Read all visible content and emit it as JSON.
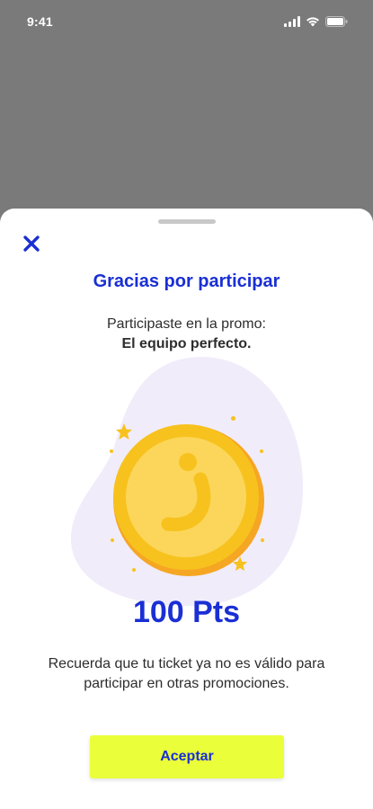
{
  "status_bar": {
    "time": "9:41",
    "icons": [
      "cellular-signal-icon",
      "wifi-icon",
      "battery-icon"
    ]
  },
  "modal": {
    "close_icon": "close-icon",
    "title": "Gracias por participar",
    "subtitle_line1": "Participaste en la promo:",
    "promo_name": "El equipo perfecto.",
    "coin_icon": "coin-icon",
    "points": "100 Pts",
    "notice": "Recuerda que tu ticket ya no es válido para participar en otras promociones.",
    "accept_label": "Aceptar"
  },
  "colors": {
    "overlay": "#7a7a7a",
    "brand_blue": "#1a2fd4",
    "button_yellow": "#eaff3a",
    "blob_lavender": "#f1ecfa",
    "coin_gold": "#f7c21e",
    "coin_inner": "#fbd65a"
  }
}
